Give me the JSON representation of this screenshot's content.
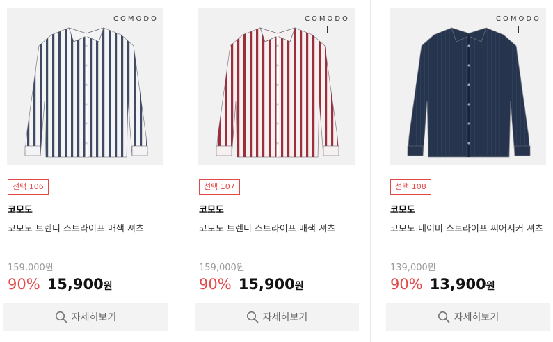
{
  "products": [
    {
      "badge": "선택 106",
      "brand": "코모도",
      "name": "코모도 트렌디 스트라이프 배색 셔츠",
      "original_price": "159,000원",
      "discount": "90%",
      "price": "15,900",
      "currency": "원",
      "button_label": "자세히보기",
      "logo_text": "COMODO",
      "shirt_style": "grey-stripe",
      "colors": {
        "base": "#f4f4f6",
        "stripe": "#3f4a63"
      }
    },
    {
      "badge": "선택 107",
      "brand": "코모도",
      "name": "코모도 트렌디 스트라이프 배색 셔츠",
      "original_price": "159,000원",
      "discount": "90%",
      "price": "15,900",
      "currency": "원",
      "button_label": "자세히보기",
      "logo_text": "COMODO",
      "shirt_style": "red-stripe",
      "colors": {
        "base": "#f7f0f1",
        "stripe": "#9c2f3c"
      }
    },
    {
      "badge": "선택 108",
      "brand": "코모도",
      "name": "코모도 네이비 스트라이프 씨어서커 셔츠",
      "original_price": "139,000원",
      "discount": "90%",
      "price": "13,900",
      "currency": "원",
      "button_label": "자세히보기",
      "logo_text": "COMODO",
      "shirt_style": "navy-solid",
      "colors": {
        "base": "#27344d",
        "stripe": "#33425e"
      }
    }
  ],
  "theme": {
    "accent": "#e34848",
    "button_bg": "#f3f3f3"
  }
}
